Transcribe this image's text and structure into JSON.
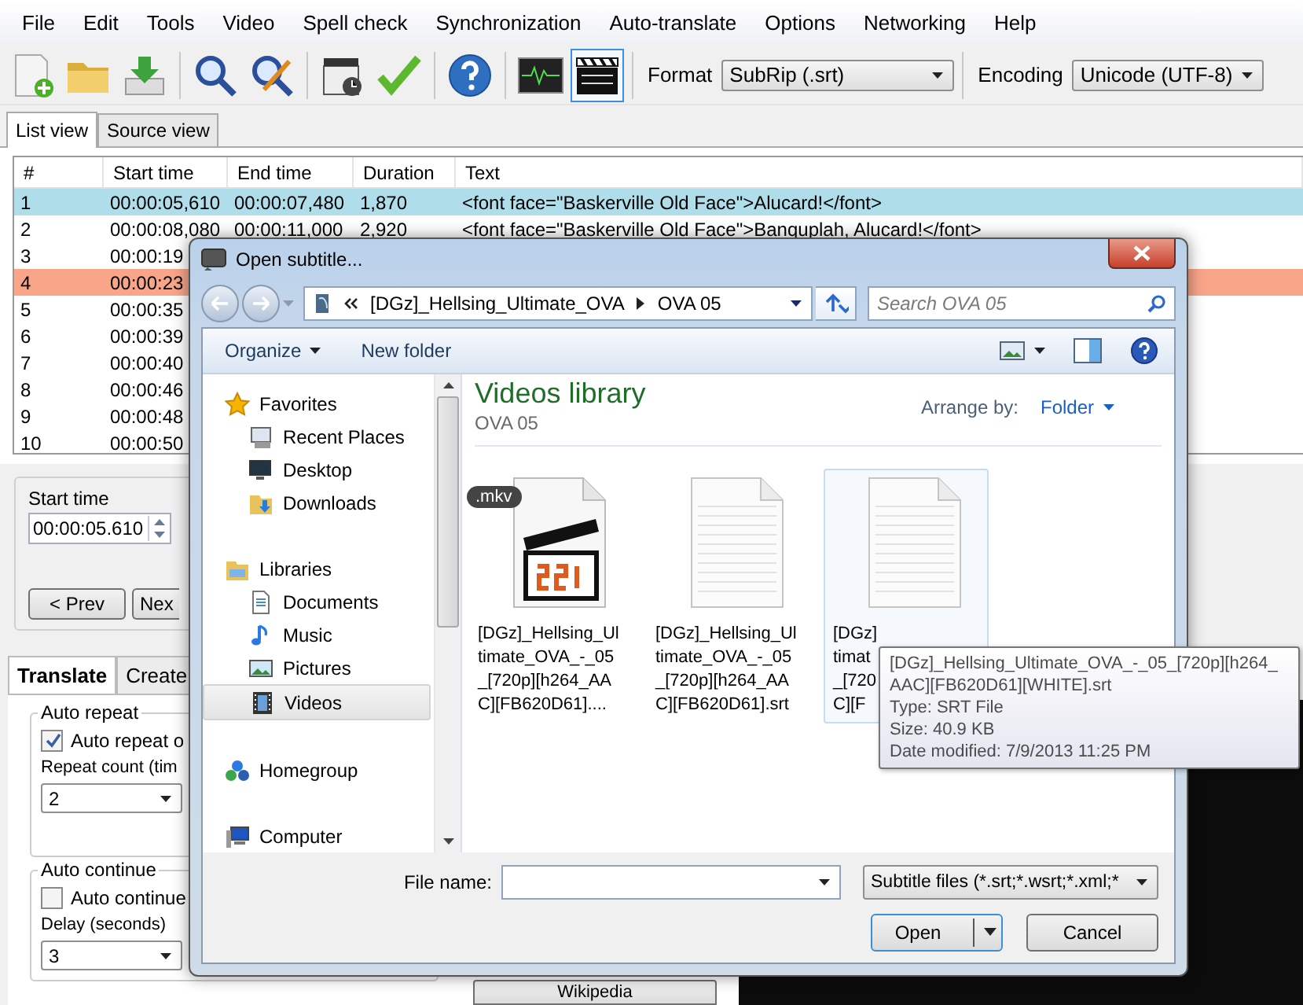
{
  "menu": [
    "File",
    "Edit",
    "Tools",
    "Video",
    "Spell check",
    "Synchronization",
    "Auto-translate",
    "Options",
    "Networking",
    "Help"
  ],
  "toolbar": {
    "groups": [
      [
        {
          "kind": "new",
          "selected": false
        },
        {
          "kind": "open",
          "selected": false
        },
        {
          "kind": "save",
          "selected": false
        }
      ],
      [
        {
          "kind": "find",
          "selected": false
        },
        {
          "kind": "replace",
          "selected": false
        }
      ],
      [
        {
          "kind": "visual-sync",
          "selected": false
        },
        {
          "kind": "spell-check",
          "selected": false
        }
      ],
      [
        {
          "kind": "help",
          "selected": false
        }
      ],
      [
        {
          "kind": "waveform",
          "selected": false
        },
        {
          "kind": "video",
          "selected": true
        }
      ]
    ],
    "format_label": "Format",
    "format_value": "SubRip (.srt)",
    "encoding_label": "Encoding",
    "encoding_value": "Unicode (UTF-8)"
  },
  "view_tabs": [
    {
      "label": "List view",
      "selected": true
    },
    {
      "label": "Source view",
      "selected": false
    }
  ],
  "table": {
    "columns": [
      "#",
      "Start time",
      "End time",
      "Duration",
      "Text"
    ],
    "rows": [
      {
        "cells": [
          "1",
          "00:00:05,610",
          "00:00:07,480",
          "1,870",
          "<font face=\"Baskerville Old Face\">Alucard!</font>"
        ],
        "selected": true,
        "flagged": false
      },
      {
        "cells": [
          "2",
          "00:00:08,080",
          "00:00:11,000",
          "2,920",
          "<font face=\"Baskerville Old Face\">Banquplah, Alucard!</font>"
        ],
        "selected": false,
        "flagged": false
      },
      {
        "cells": [
          "3",
          "00:00:19"
        ],
        "selected": false,
        "flagged": false
      },
      {
        "cells": [
          "4",
          "00:00:23"
        ],
        "selected": false,
        "flagged": true
      },
      {
        "cells": [
          "5",
          "00:00:35"
        ],
        "selected": false,
        "flagged": false
      },
      {
        "cells": [
          "6",
          "00:00:39"
        ],
        "selected": false,
        "flagged": false
      },
      {
        "cells": [
          "7",
          "00:00:40"
        ],
        "selected": false,
        "flagged": false
      },
      {
        "cells": [
          "8",
          "00:00:46"
        ],
        "selected": false,
        "flagged": false
      },
      {
        "cells": [
          "9",
          "00:00:48"
        ],
        "selected": false,
        "flagged": false
      },
      {
        "cells": [
          "10",
          "00:00:50"
        ],
        "selected": false,
        "flagged": false
      }
    ]
  },
  "editor": {
    "start_time_label": "Start time",
    "start_time": "00:00:05.610",
    "prev_button": "< Prev",
    "next_button": "Nex"
  },
  "bottom_tabs": [
    {
      "label": "Translate",
      "selected": true
    },
    {
      "label": "Create",
      "selected": false
    }
  ],
  "auto_repeat": {
    "title": "Auto repeat",
    "checkbox": {
      "label": "Auto repeat o",
      "checked": true
    },
    "count_label": "Repeat count (tim",
    "count_value": "2"
  },
  "auto_continue": {
    "title": "Auto continue",
    "checkbox": {
      "label": "Auto continue",
      "checked": false
    },
    "delay_label": "Delay (seconds)",
    "delay_value": "3"
  },
  "wikipedia_button": "Wikipedia",
  "dialog": {
    "title": "Open subtitle...",
    "breadcrumb": [
      "[DGz]_Hellsing_Ultimate_OVA",
      "OVA 05"
    ],
    "search_placeholder": "Search OVA 05",
    "commands": [
      "Organize",
      "New folder"
    ],
    "nav": [
      {
        "label": "Favorites",
        "kind": "star",
        "selected": false,
        "children": [
          {
            "label": "Recent Places",
            "kind": "recent",
            "selected": false
          },
          {
            "label": "Desktop",
            "kind": "desktop",
            "selected": false
          },
          {
            "label": "Downloads",
            "kind": "downloads",
            "selected": false
          }
        ]
      },
      {
        "label": "Libraries",
        "kind": "libraries",
        "selected": false,
        "children": [
          {
            "label": "Documents",
            "kind": "documents",
            "selected": false
          },
          {
            "label": "Music",
            "kind": "music",
            "selected": false
          },
          {
            "label": "Pictures",
            "kind": "pictures",
            "selected": false
          },
          {
            "label": "Videos",
            "kind": "videos",
            "selected": true
          }
        ]
      },
      {
        "label": "Homegroup",
        "kind": "homegroup",
        "selected": false
      },
      {
        "label": "Computer",
        "kind": "computer",
        "selected": false
      }
    ],
    "library_title": "Videos library",
    "library_subtitle": "OVA 05",
    "arrange_label": "Arrange by:",
    "arrange_value": "Folder",
    "files": [
      {
        "kind": "video",
        "badge": ".mkv",
        "lines": [
          "[DGz]_Hellsing_Ul",
          "timate_OVA_-_05",
          "_[720p][h264_AA",
          "C][FB620D61]...."
        ],
        "selected": false
      },
      {
        "kind": "document",
        "lines": [
          "[DGz]_Hellsing_Ul",
          "timate_OVA_-_05",
          "_[720p][h264_AA",
          "C][FB620D61].srt"
        ],
        "selected": false
      },
      {
        "kind": "document",
        "lines": [
          "[DGz]",
          "timat",
          "_[720",
          "C][F"
        ],
        "selected": true
      }
    ],
    "tooltip": [
      "[DGz]_Hellsing_Ultimate_OVA_-_05_[720p][h264_AAC][FB620D61][WHITE].srt",
      "Type: SRT File",
      "Size: 40.9 KB",
      "Date modified: 7/9/2013 11:25 PM"
    ],
    "file_name_label": "File name:",
    "filter": "Subtitle files (*.srt;*.wsrt;*.xml;*",
    "open_button": "Open",
    "cancel_button": "Cancel"
  }
}
